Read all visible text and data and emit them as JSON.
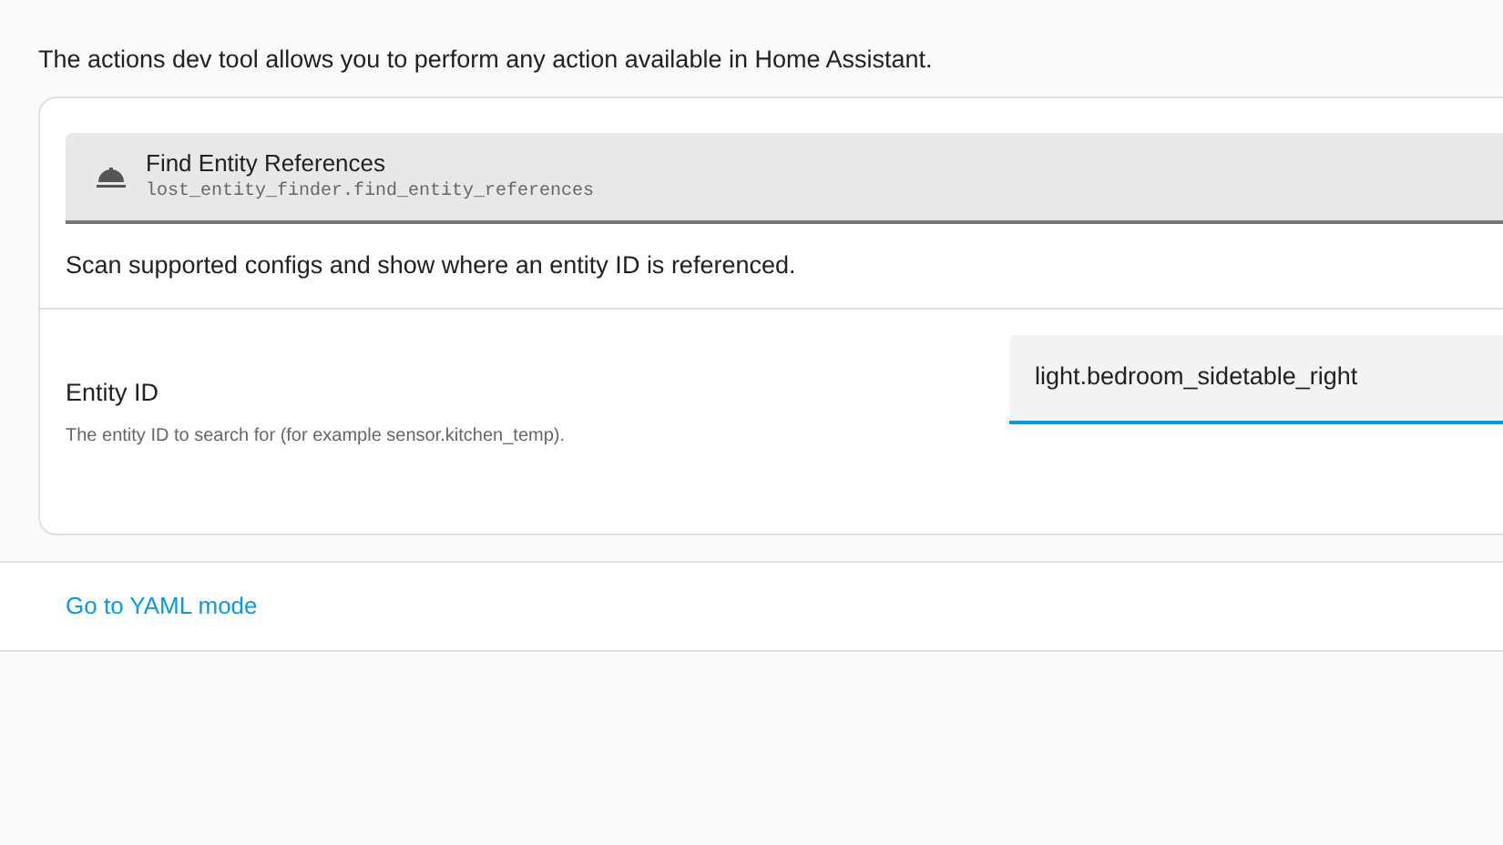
{
  "intro": "The actions dev tool allows you to perform any action available in Home Assistant.",
  "action": {
    "name": "Find Entity References",
    "id": "lost_entity_finder.find_entity_references",
    "description": "Scan supported configs and show where an entity ID is referenced."
  },
  "fields": [
    {
      "label": "Entity ID",
      "help": "The entity ID to search for (for example sensor.kitchen_temp).",
      "value": "light.bedroom_sidetable_right"
    }
  ],
  "yaml_link": "Go to YAML mode"
}
